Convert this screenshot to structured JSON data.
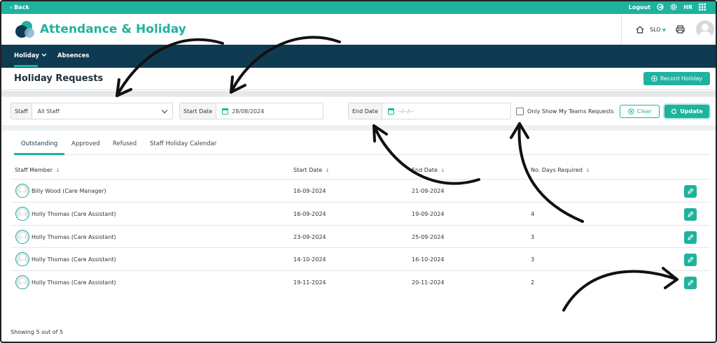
{
  "topbar": {
    "back": "‹ Back",
    "logout": "Logout",
    "user_initials": "HR"
  },
  "header": {
    "app_title": "Attendance & Holiday",
    "location": "SLO"
  },
  "nav": {
    "items": [
      {
        "label": "Holiday",
        "active": true
      },
      {
        "label": "Absences",
        "active": false
      }
    ]
  },
  "page": {
    "title": "Holiday Requests",
    "record_button": "Record Holiday"
  },
  "filters": {
    "staff_label": "Staff",
    "staff_value": "All Staff",
    "start_label": "Start Date",
    "start_value": "28/08/2024",
    "end_label": "End Date",
    "end_placeholder": "--/--/--",
    "team_checkbox_label": "Only Show My Teams Requests",
    "clear_button": "Clear",
    "update_button": "Update"
  },
  "tabs": [
    "Outstanding",
    "Approved",
    "Refused",
    "Staff Holiday Calendar"
  ],
  "table": {
    "columns": [
      "Staff Member",
      "Start Date",
      "End Date",
      "No. Days Required"
    ],
    "rows": [
      {
        "staff": "Billy Wood (Care Manager)",
        "start": "16-09-2024",
        "end": "21-09-2024",
        "days": ""
      },
      {
        "staff": "Holly Thomas (Care Assistant)",
        "start": "16-09-2024",
        "end": "19-09-2024",
        "days": "4"
      },
      {
        "staff": "Holly Thomas (Care Assistant)",
        "start": "23-09-2024",
        "end": "25-09-2024",
        "days": "3"
      },
      {
        "staff": "Holly Thomas (Care Assistant)",
        "start": "14-10-2024",
        "end": "16-10-2024",
        "days": "3"
      },
      {
        "staff": "Holly Thomas (Care Assistant)",
        "start": "19-11-2024",
        "end": "20-11-2024",
        "days": "2"
      }
    ]
  },
  "footer": {
    "showing": "Showing 5 out of 5"
  },
  "colors": {
    "accent": "#1fb39e",
    "nav_bg": "#0e3a52",
    "title": "#1e2f3c"
  }
}
